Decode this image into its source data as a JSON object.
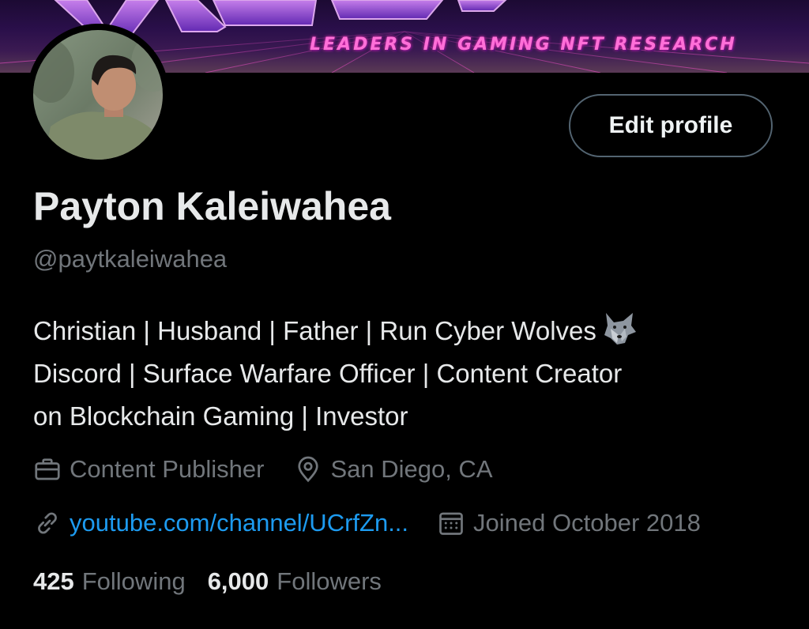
{
  "banner": {
    "tagline": "LEADERS IN GAMING NFT RESEARCH",
    "accent_color": "#ff6fd8"
  },
  "profile": {
    "avatar_icon": "profile-photo",
    "edit_button_label": "Edit profile",
    "name": "Payton Kaleiwahea",
    "handle": "@paytkaleiwahea",
    "bio_lines": [
      "Christian | Husband | Father | Run Cyber Wolves",
      "Discord | Surface Warfare Officer | Content Creator",
      "on Blockchain Gaming | Investor"
    ],
    "bio_emoji": "wolf-emoji"
  },
  "meta": {
    "category": "Content Publisher",
    "category_icon": "briefcase-icon",
    "location": "San Diego, CA",
    "location_icon": "location-pin-icon",
    "website": "youtube.com/channel/UCrfZn...",
    "website_icon": "link-icon",
    "joined": "Joined October 2018",
    "joined_icon": "calendar-icon"
  },
  "stats": {
    "following_count": "425",
    "following_label": "Following",
    "followers_count": "6,000",
    "followers_label": "Followers"
  },
  "colors": {
    "background": "#000000",
    "primary_text": "#e7e9ea",
    "secondary_text": "#71767b",
    "link": "#1d9bf0",
    "button_border": "#536471"
  }
}
